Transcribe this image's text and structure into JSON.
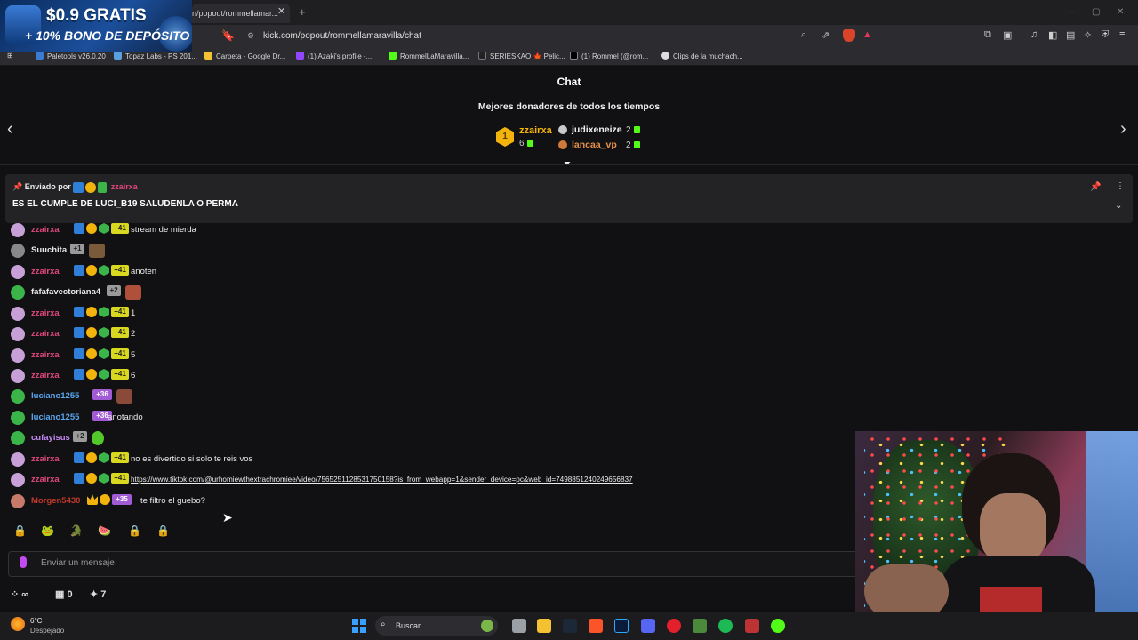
{
  "promo": {
    "line1": "$0.9 GRATIS",
    "line2": "+ 10% BONO DE DEPÓSITO"
  },
  "browser": {
    "tab_title": "n/popout/rommellamar...",
    "url": "kick.com/popout/rommellamaravilla/chat",
    "bookmarks": [
      "Paletools v26.0.20",
      "Topaz Labs - PS 201...",
      "Carpeta - Google Dr...",
      "(1) Azaki's profile -...",
      "RommelLaMaravilla...",
      "SERIESKAO 🍁 Pelic...",
      "(1) Rommel (@rom...",
      "Clips de la muchach..."
    ]
  },
  "chat": {
    "title": "Chat",
    "donors_title": "Mejores donadores de todos los tiempos",
    "top_donor": {
      "rank": "1",
      "name": "zzairxa",
      "value": "6"
    },
    "donors": [
      {
        "name": "judixeneize",
        "value": "2"
      },
      {
        "name": "lancaa_vp",
        "value": "2"
      }
    ],
    "pinned": {
      "by_label": "Enviado por",
      "by_user": "zzairxa",
      "message": "ES EL CUMPLE DE LUCI_B19 SALUDENLA O PERMA"
    },
    "messages": [
      {
        "user": "zzairxa",
        "text": "stream de mierda"
      },
      {
        "user": "Suuchita",
        "badge": "+1",
        "text": ""
      },
      {
        "user": "zzairxa",
        "text": "anoten"
      },
      {
        "user": "fafafavectoriana4",
        "badge": "+2",
        "text": ""
      },
      {
        "user": "zzairxa",
        "text": "1"
      },
      {
        "user": "zzairxa",
        "text": "2"
      },
      {
        "user": "zzairxa",
        "text": "5"
      },
      {
        "user": "zzairxa",
        "text": "6"
      },
      {
        "user": "luciano1255",
        "badge": "+36",
        "text": ""
      },
      {
        "user": "luciano1255",
        "badge": "+36",
        "text": "anotando"
      },
      {
        "user": "cufayisus",
        "badge": "+2",
        "text": ""
      },
      {
        "user": "zzairxa",
        "text": "no es divertido si solo te reis vos"
      },
      {
        "user": "zzairxa",
        "text": "https://www.tiktok.com/@urhomiewthextrachromiee/video/7565251128531750158?is_from_webapp=1&sender_device=pc&web_id=7498851240249656837"
      },
      {
        "user": "Morgen5430",
        "badge": "+35",
        "text": "te filtro el guebo?"
      }
    ],
    "sub_badge": "+41",
    "input_placeholder": "Enviar un mensaje",
    "stats": {
      "infinite": "∞",
      "gifts": "0",
      "points": "7"
    }
  },
  "taskbar": {
    "temp": "6°C",
    "weather": "Despejado",
    "search": "Buscar"
  }
}
